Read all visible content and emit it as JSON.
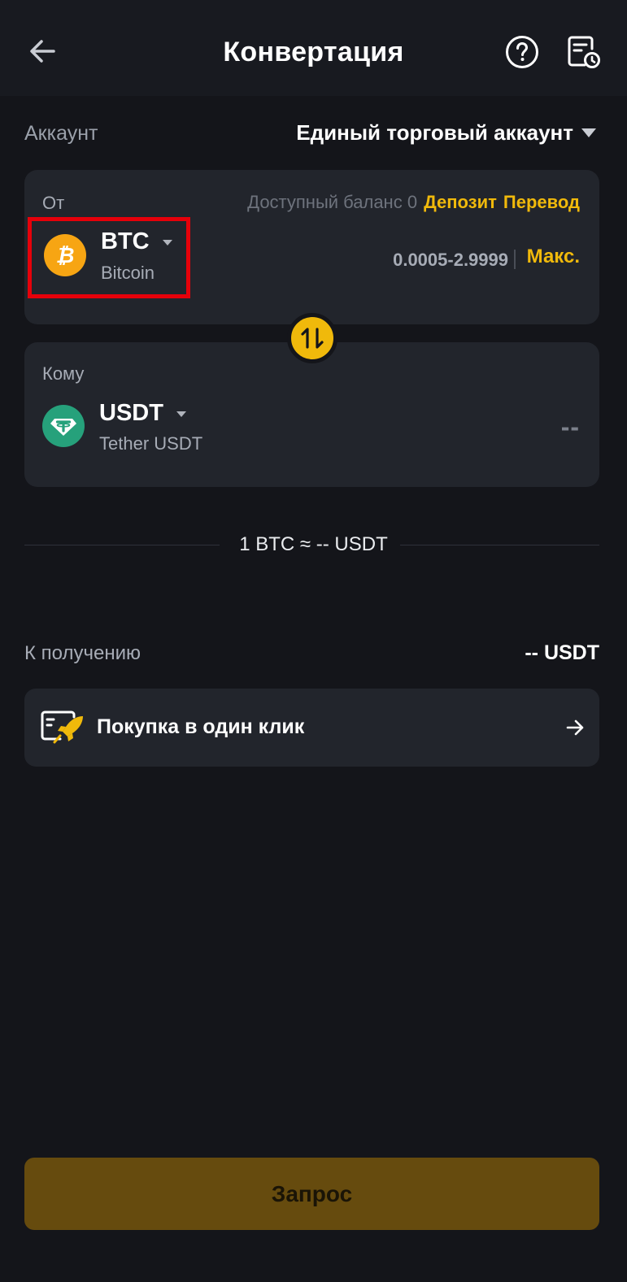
{
  "header": {
    "title": "Конвертация"
  },
  "account": {
    "label": "Аккаунт",
    "selected": "Единый торговый аккаунт"
  },
  "from": {
    "label": "От",
    "balance_text": "Доступный баланс 0",
    "deposit_label": "Депозит",
    "transfer_label": "Перевод",
    "coin_symbol": "BTC",
    "coin_name": "Bitcoin",
    "amount_range": "0.0005-2.9999",
    "max_label": "Макс."
  },
  "to": {
    "label": "Кому",
    "coin_symbol": "USDT",
    "coin_name": "Tether USDT",
    "amount": "--"
  },
  "rate": {
    "text": "1 BTC ≈ -- USDT"
  },
  "receive": {
    "label": "К получению",
    "value": "-- USDT"
  },
  "quick_buy": {
    "label": "Покупка в один клик"
  },
  "submit": {
    "label": "Запрос"
  },
  "colors": {
    "background": "#14151a",
    "card": "#22252c",
    "accent": "#f0b90b",
    "btc": "#f7a513",
    "usdt": "#26a17b",
    "highlight": "#e6000a"
  },
  "icons": [
    "arrow-left-icon",
    "help-icon",
    "history-icon",
    "bitcoin-icon",
    "tether-icon",
    "swap-icon",
    "rocket-card-icon",
    "arrow-right-icon"
  ]
}
